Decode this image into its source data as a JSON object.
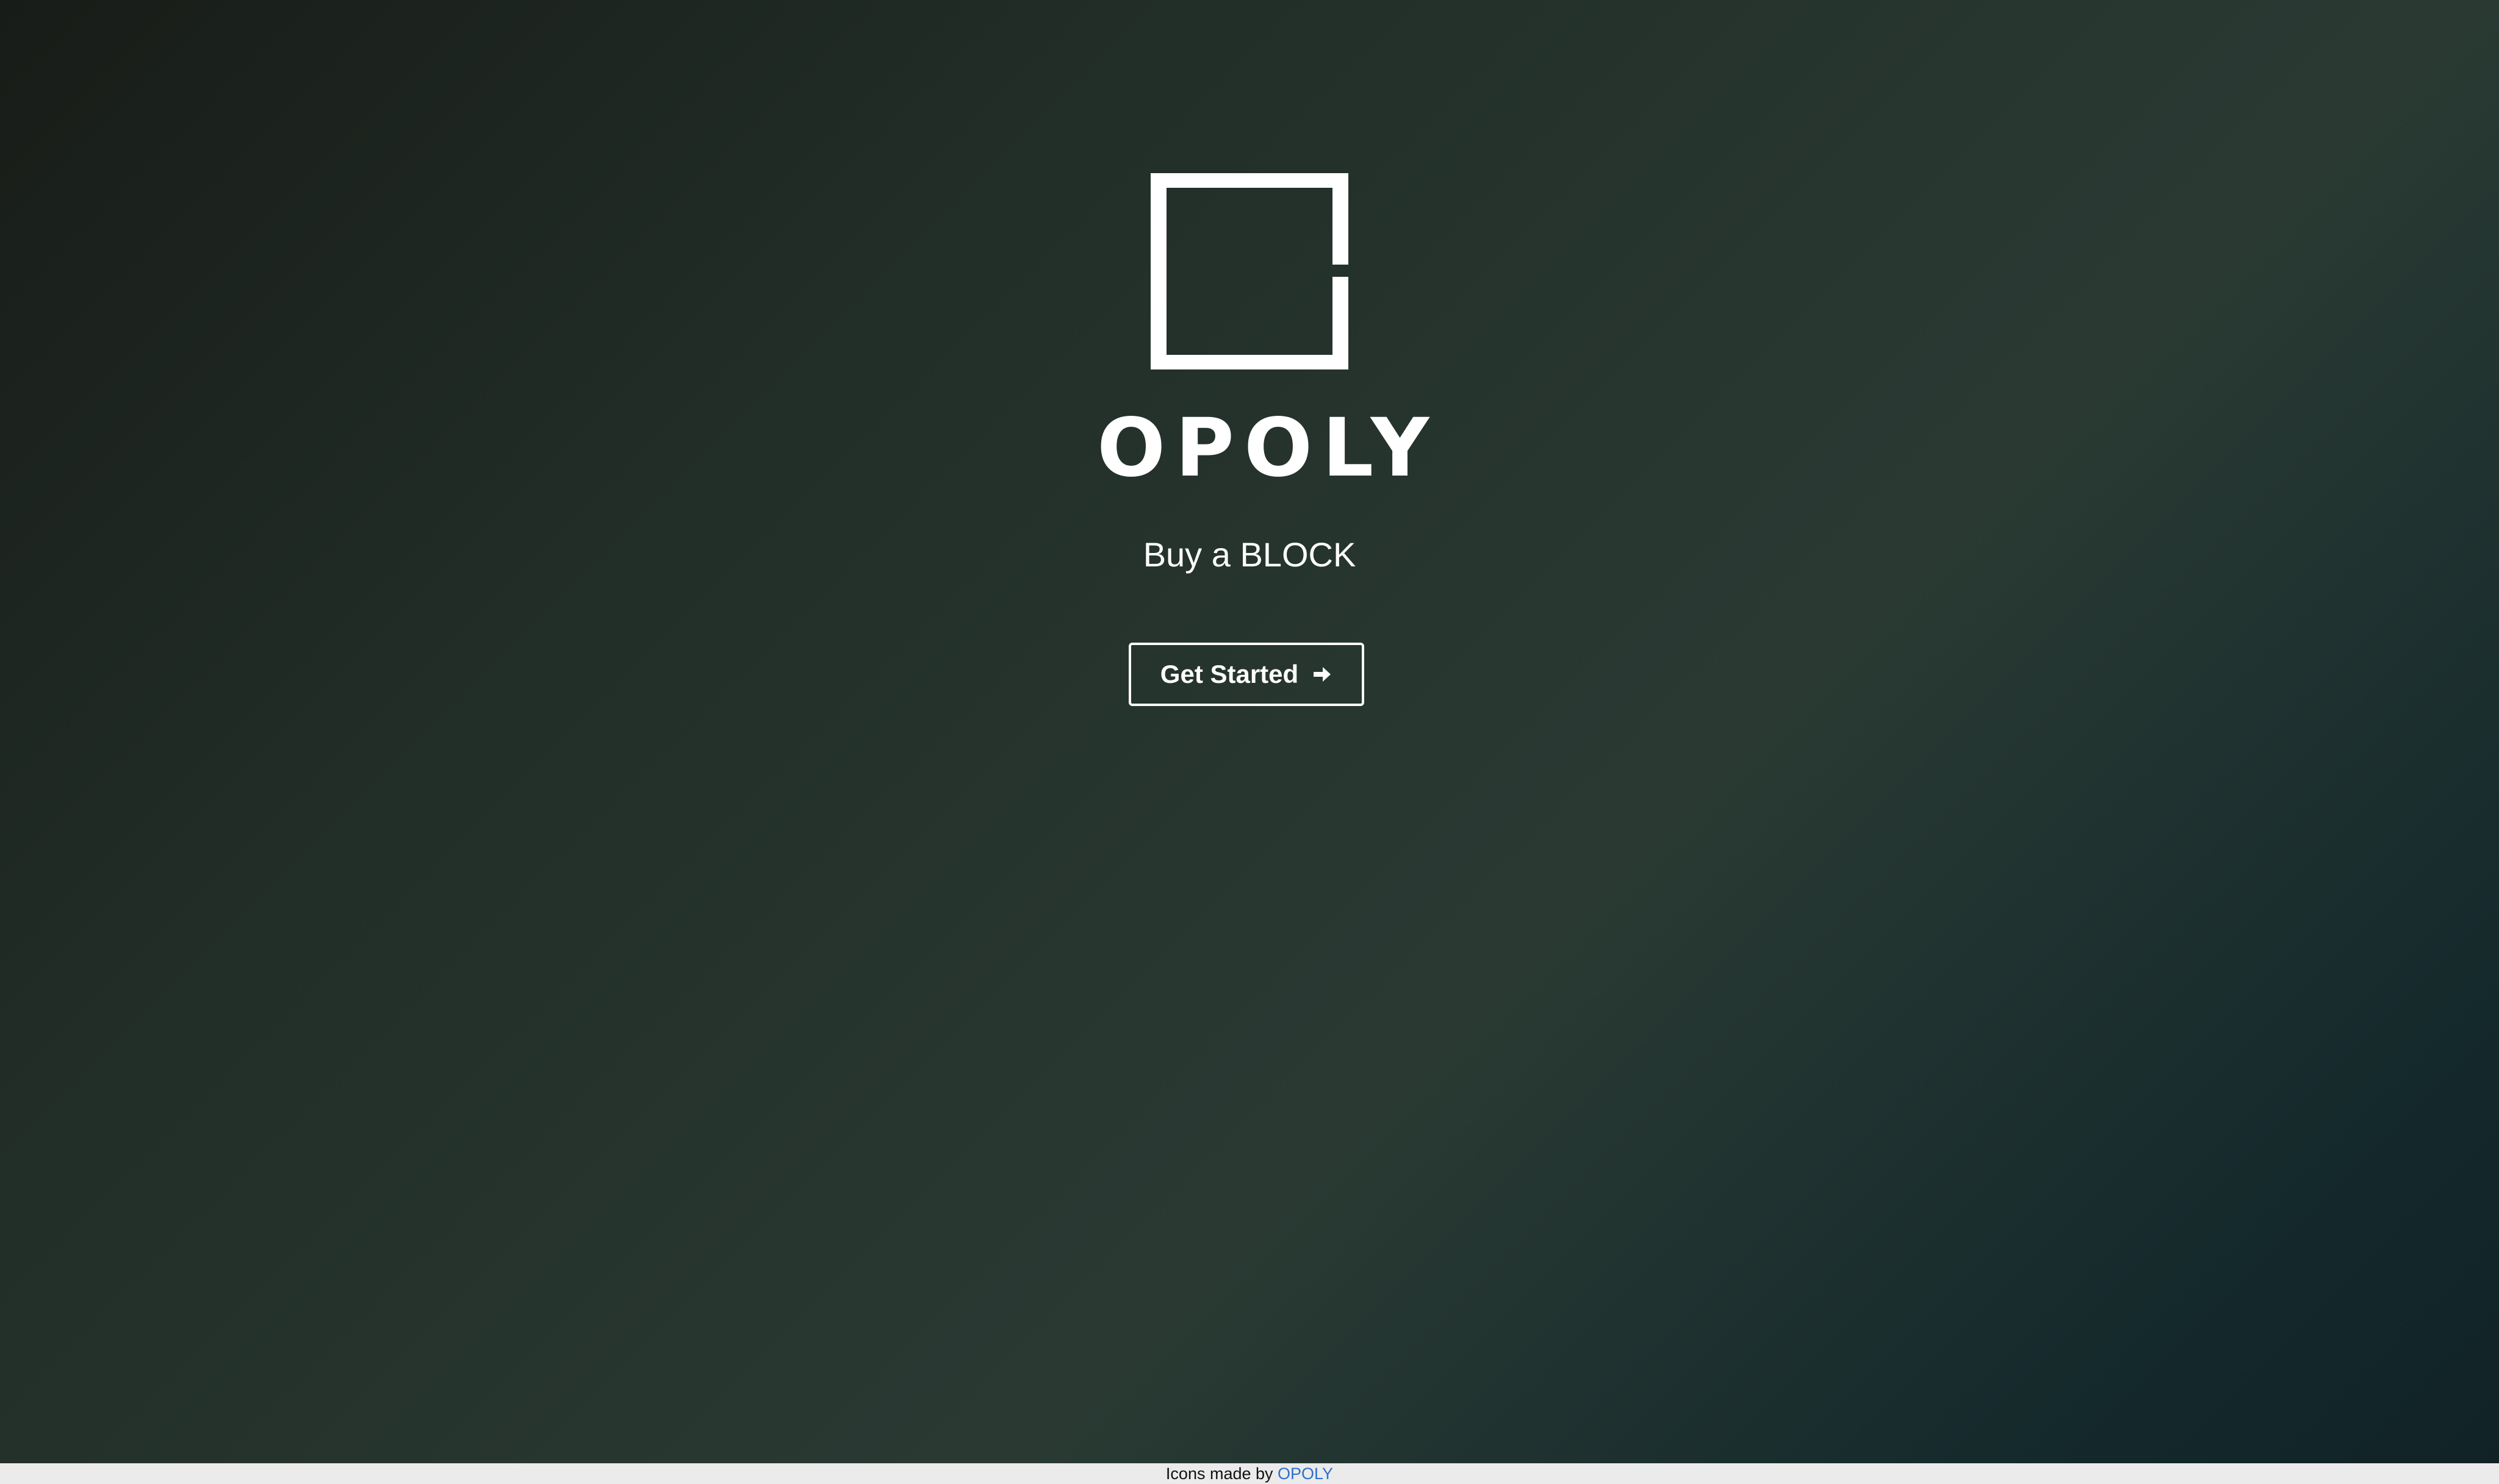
{
  "brand": {
    "name": "OPOLY",
    "logo_icon": "open-square-logo-icon"
  },
  "hero": {
    "tagline": "Buy a BLOCK",
    "cta_label": "Get Started",
    "cta_icon": "arrow-right-icon"
  },
  "footer": {
    "credit_text": "Icons made by ",
    "credit_link": "OPOLY"
  },
  "colors": {
    "text": "#ffffff",
    "footer_bg": "#ebebeb",
    "link": "#2f6fd1",
    "bg_dark": "#181c18",
    "bg_mid": "#2a3a33",
    "bg_teal": "#112226"
  }
}
